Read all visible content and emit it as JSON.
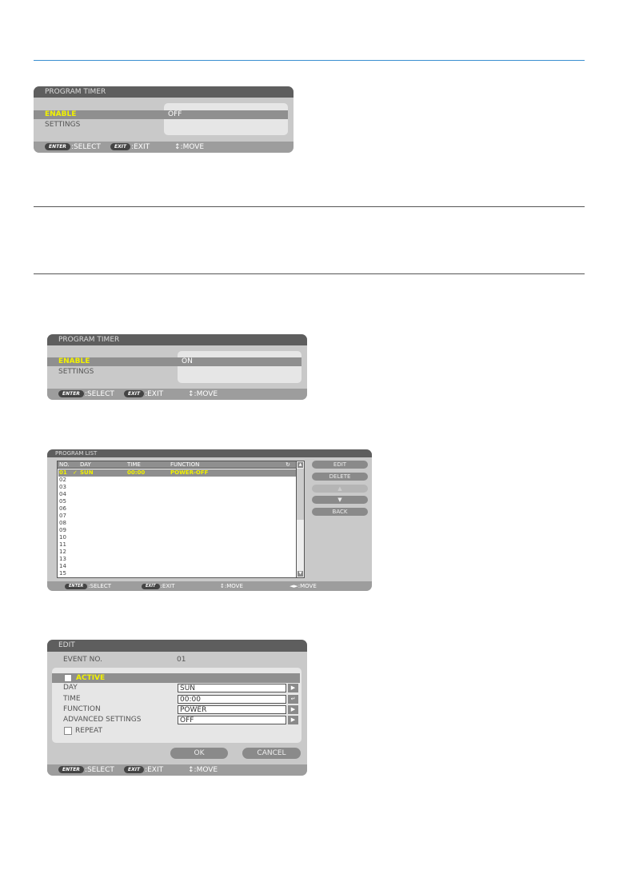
{
  "timer_off": {
    "title": "PROGRAM TIMER",
    "enable_label": "ENABLE",
    "settings_label": "SETTINGS",
    "enable_value": "OFF"
  },
  "timer_on": {
    "title": "PROGRAM TIMER",
    "enable_label": "ENABLE",
    "settings_label": "SETTINGS",
    "enable_value": "ON"
  },
  "footer": {
    "enter_key": "ENTER",
    "select": ":SELECT",
    "exit_key": "EXIT",
    "exit": ":EXIT",
    "move": "↕:MOVE",
    "move_lr": "◄►:MOVE"
  },
  "program_list": {
    "title": "PROGRAM LIST",
    "columns": [
      "NO.",
      "DAY",
      "TIME",
      "FUNCTION",
      "↻"
    ],
    "rows": [
      {
        "no": "01",
        "check": "✓",
        "day": "SUN",
        "time": "00:00",
        "function": "POWER-OFF"
      },
      {
        "no": "02"
      },
      {
        "no": "03"
      },
      {
        "no": "04"
      },
      {
        "no": "05"
      },
      {
        "no": "06"
      },
      {
        "no": "07"
      },
      {
        "no": "08"
      },
      {
        "no": "09"
      },
      {
        "no": "10"
      },
      {
        "no": "11"
      },
      {
        "no": "12"
      },
      {
        "no": "13"
      },
      {
        "no": "14"
      },
      {
        "no": "15"
      }
    ],
    "buttons": {
      "edit": "EDIT",
      "delete": "DELETE",
      "up": "▲",
      "down": "▼",
      "back": "BACK"
    }
  },
  "edit": {
    "title": "EDIT",
    "event_no_label": "EVENT NO.",
    "event_no_value": "01",
    "active_label": "ACTIVE",
    "active_checked": false,
    "day_label": "DAY",
    "day_value": "SUN",
    "time_label": "TIME",
    "time_value": "00:00",
    "function_label": "FUNCTION",
    "function_value": "POWER",
    "advanced_label": "ADVANCED SETTINGS",
    "advanced_value": "OFF",
    "repeat_label": "REPEAT",
    "repeat_checked": false,
    "ok": "OK",
    "cancel": "CANCEL"
  },
  "colors": {
    "accent_line": "#3a8fd0",
    "highlight_text": "#f2f200",
    "panel": "#c9c9c9",
    "title_bar": "#5e5e5e"
  }
}
